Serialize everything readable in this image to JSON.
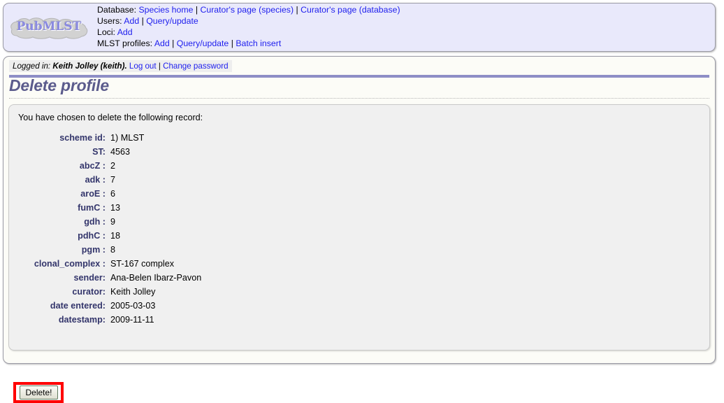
{
  "header": {
    "logo_text": "PubMLST",
    "nav_rows": [
      {
        "label": "Database:",
        "links": [
          "Species home",
          "Curator's page (species)",
          "Curator's page (database)"
        ]
      },
      {
        "label": "Users:",
        "links": [
          "Add",
          "Query/update"
        ]
      },
      {
        "label": "Loci:",
        "links": [
          "Add"
        ]
      },
      {
        "label": "MLST profiles:",
        "links": [
          "Add",
          "Query/update",
          "Batch insert"
        ]
      }
    ],
    "separator": "|"
  },
  "login": {
    "prefix": "Logged in:",
    "user": "Keith Jolley (keith).",
    "logout_label": "Log out",
    "separator": "|",
    "change_password_label": "Change password"
  },
  "page": {
    "title": "Delete profile",
    "intro": "You have chosen to delete the following record:"
  },
  "record": {
    "rows": [
      {
        "label": "scheme id:",
        "value": "1) MLST"
      },
      {
        "label": "ST:",
        "value": "4563"
      },
      {
        "label": "abcZ :",
        "value": "2"
      },
      {
        "label": "adk :",
        "value": "7"
      },
      {
        "label": "aroE :",
        "value": "6"
      },
      {
        "label": "fumC :",
        "value": "13"
      },
      {
        "label": "gdh :",
        "value": "9"
      },
      {
        "label": "pdhC :",
        "value": "18"
      },
      {
        "label": "pgm :",
        "value": "8"
      },
      {
        "label": "clonal_complex :",
        "value": "ST-167 complex"
      },
      {
        "label": "sender:",
        "value": "Ana-Belen Ibarz-Pavon"
      },
      {
        "label": "curator:",
        "value": "Keith Jolley"
      },
      {
        "label": "date entered:",
        "value": "2005-03-03"
      },
      {
        "label": "datestamp:",
        "value": "2009-11-11"
      }
    ]
  },
  "actions": {
    "delete_label": "Delete!"
  },
  "colors": {
    "link": "#2020ee",
    "label": "#33356b",
    "title": "#5b5b8c",
    "header_bg": "#e9e9fb",
    "panel_bg": "#f0f0f0",
    "annotation": "#ff0000",
    "title_rule": "#8e8ec6"
  }
}
